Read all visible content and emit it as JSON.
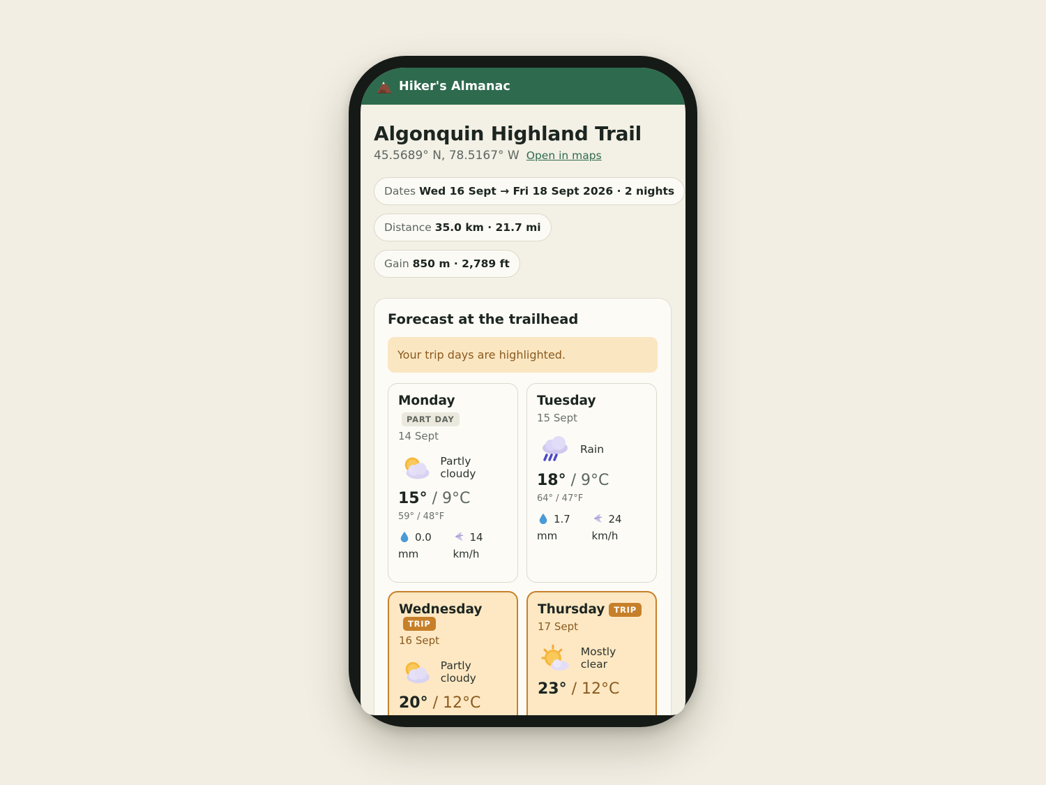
{
  "app": {
    "title": "Hiker's Almanac",
    "logo_icon": "mountain-icon"
  },
  "trail": {
    "name": "Algonquin Highland Trail",
    "coords": "45.5689° N, 78.5167° W",
    "maps_link": "Open in maps"
  },
  "chips": {
    "dates": {
      "label": "Dates",
      "value": "Wed 16 Sept → Fri 18 Sept 2026 · 2 nights"
    },
    "distance": {
      "label": "Distance",
      "value": "35.0 km · 21.7 mi"
    },
    "gain": {
      "label": "Gain",
      "value": "850 m · 2,789 ft"
    }
  },
  "forecast": {
    "title": "Forecast at the trailhead",
    "notice": "Your trip days are highlighted.",
    "days": [
      {
        "name": "Monday",
        "badge": "PART DAY",
        "date": "14 Sept",
        "condition": "Partly cloudy",
        "icon": "partly-cloudy-icon",
        "hi": "15°",
        "lo": "/ 9°C",
        "fahrenheit": "59° / 48°F",
        "precip_value": "0.0",
        "precip_unit": "mm",
        "wind_value": "14",
        "wind_unit": "km/h"
      },
      {
        "name": "Tuesday",
        "badge": "",
        "date": "15 Sept",
        "condition": "Rain",
        "icon": "rain-icon",
        "hi": "18°",
        "lo": "/ 9°C",
        "fahrenheit": "64° / 47°F",
        "precip_value": "1.7",
        "precip_unit": "mm",
        "wind_value": "24",
        "wind_unit": "km/h"
      },
      {
        "name": "Wednesday",
        "badge": "TRIP",
        "date": "16 Sept",
        "condition": "Partly cloudy",
        "icon": "partly-cloudy-icon",
        "hi": "20°",
        "lo": "/ 12°C"
      },
      {
        "name": "Thursday",
        "badge": "TRIP",
        "date": "17 Sept",
        "condition": "Mostly clear",
        "icon": "mostly-clear-icon",
        "hi": "23°",
        "lo": "/ 12°C"
      }
    ]
  },
  "colors": {
    "appbar": "#2e6b4e",
    "trip_accent": "#c7802a",
    "trip_background": "#fde8c3",
    "notice_background": "#fbe6c2"
  }
}
